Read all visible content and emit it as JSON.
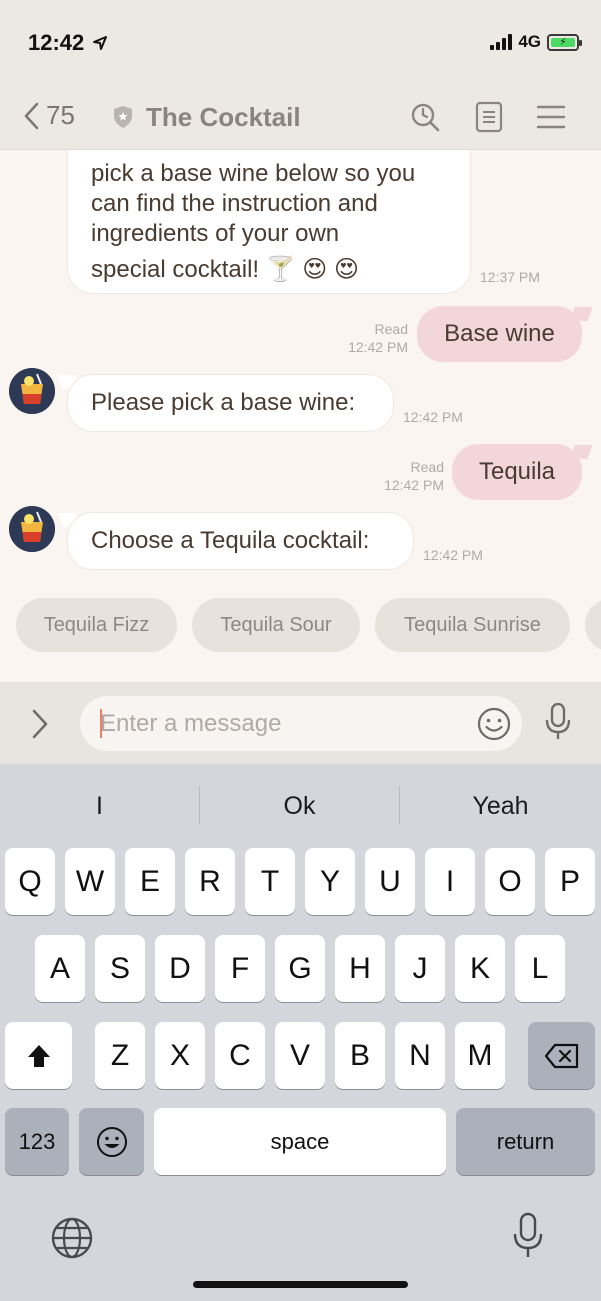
{
  "status_bar": {
    "time": "12:42",
    "network": "4G",
    "location_icon": "location-arrow-icon",
    "battery_icon": "battery-charging-icon"
  },
  "nav": {
    "back_count": "75",
    "title": "The Cocktail",
    "icons": [
      "chevron-left-icon",
      "shield-icon",
      "search-icon",
      "notes-icon",
      "menu-icon"
    ]
  },
  "chat": {
    "messages": [
      {
        "from": "bot",
        "lines": [
          "pick a base wine below so you",
          "can find the instruction and",
          "ingredients of your own",
          "special cocktail! 🍸 😍 😍"
        ],
        "time": "12:37 PM"
      },
      {
        "from": "user",
        "text": "Base wine",
        "read": "Read",
        "time": "12:42 PM"
      },
      {
        "from": "bot",
        "text": "Please pick a base wine:",
        "time": "12:42 PM"
      },
      {
        "from": "user",
        "text": "Tequila",
        "read": "Read",
        "time": "12:42 PM"
      },
      {
        "from": "bot",
        "text": "Choose a Tequila cocktail:",
        "time": "12:42 PM"
      }
    ],
    "quick_replies": [
      "Tequila Fizz",
      "Tequila Sour",
      "Tequila Sunrise"
    ]
  },
  "input": {
    "placeholder": "Enter a message",
    "value": ""
  },
  "keyboard": {
    "suggestions": [
      "I",
      "Ok",
      "Yeah"
    ],
    "row1": [
      "Q",
      "W",
      "E",
      "R",
      "T",
      "Y",
      "U",
      "I",
      "O",
      "P"
    ],
    "row2": [
      "A",
      "S",
      "D",
      "F",
      "G",
      "H",
      "J",
      "K",
      "L"
    ],
    "row3": [
      "Z",
      "X",
      "C",
      "V",
      "B",
      "N",
      "M"
    ],
    "numbers_label": "123",
    "space_label": "space",
    "return_label": "return"
  },
  "colors": {
    "accent": "#e8806c",
    "outgoing_bubble": "#f2d6da",
    "chat_bg": "#faf5f1"
  }
}
